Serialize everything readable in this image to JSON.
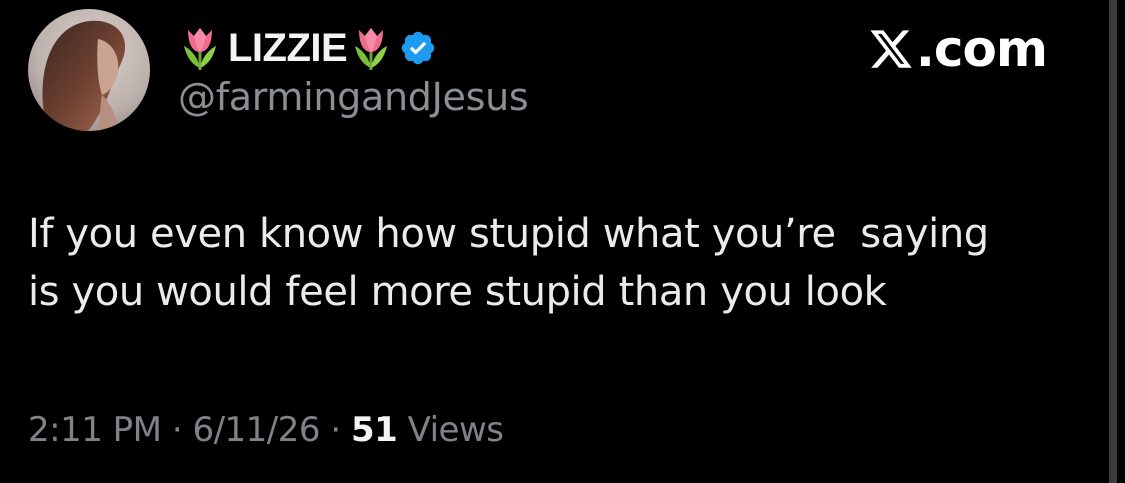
{
  "tweet": {
    "display_name": "LIZZIE",
    "name_emoji": "tulip",
    "verified": true,
    "handle": "@farmingandJesus",
    "text": "If you even know how stupid what you’re  saying\nis you would feel more stupid than you look",
    "time": "2:11 PM",
    "separator": "·",
    "date": "6/11/26",
    "views_count": "51",
    "views_label": "Views"
  },
  "brand": {
    "icon": "x-logo-icon",
    "text": ".com"
  },
  "colors": {
    "background": "#000000",
    "verified_badge": "#1d9bf0",
    "muted_text": "#7f8388",
    "tulip_petal": "#f06c8f",
    "tulip_leaf": "#7bbf3a"
  }
}
